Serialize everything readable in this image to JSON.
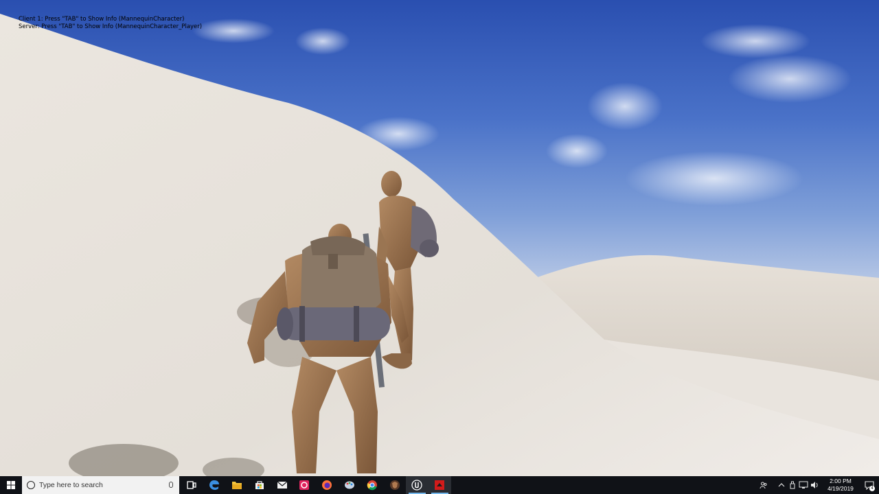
{
  "debug": {
    "line1": "Client 1: Press \"TAB\" to Show Info (MannequinCharacter)",
    "line2": "Server: Press \"TAB\" to Show Info (MannequinCharacter_Player)"
  },
  "taskbar": {
    "search_placeholder": "Type here to search",
    "clock_time": "2:00 PM",
    "clock_date": "4/19/2019",
    "notification_count": "4",
    "pinned_apps": [
      {
        "name": "edge-icon",
        "color": "#3277bc"
      },
      {
        "name": "file-explorer-icon",
        "color": "#f3c33c"
      },
      {
        "name": "store-icon",
        "color": "#f2f2f2"
      },
      {
        "name": "mail-icon",
        "color": "#f2f2f2"
      },
      {
        "name": "red-app-icon",
        "color": "#e0245e"
      },
      {
        "name": "firefox-icon",
        "color": "#ff7139"
      },
      {
        "name": "paint-icon",
        "color": "#9bb8d8"
      },
      {
        "name": "chrome-icon",
        "color": "#4caf50"
      },
      {
        "name": "shield-app-icon",
        "color": "#8a5a3c"
      },
      {
        "name": "unreal-engine-icon",
        "color": "#ffffff"
      },
      {
        "name": "red-square-app-icon",
        "color": "#d21b1b"
      }
    ]
  }
}
